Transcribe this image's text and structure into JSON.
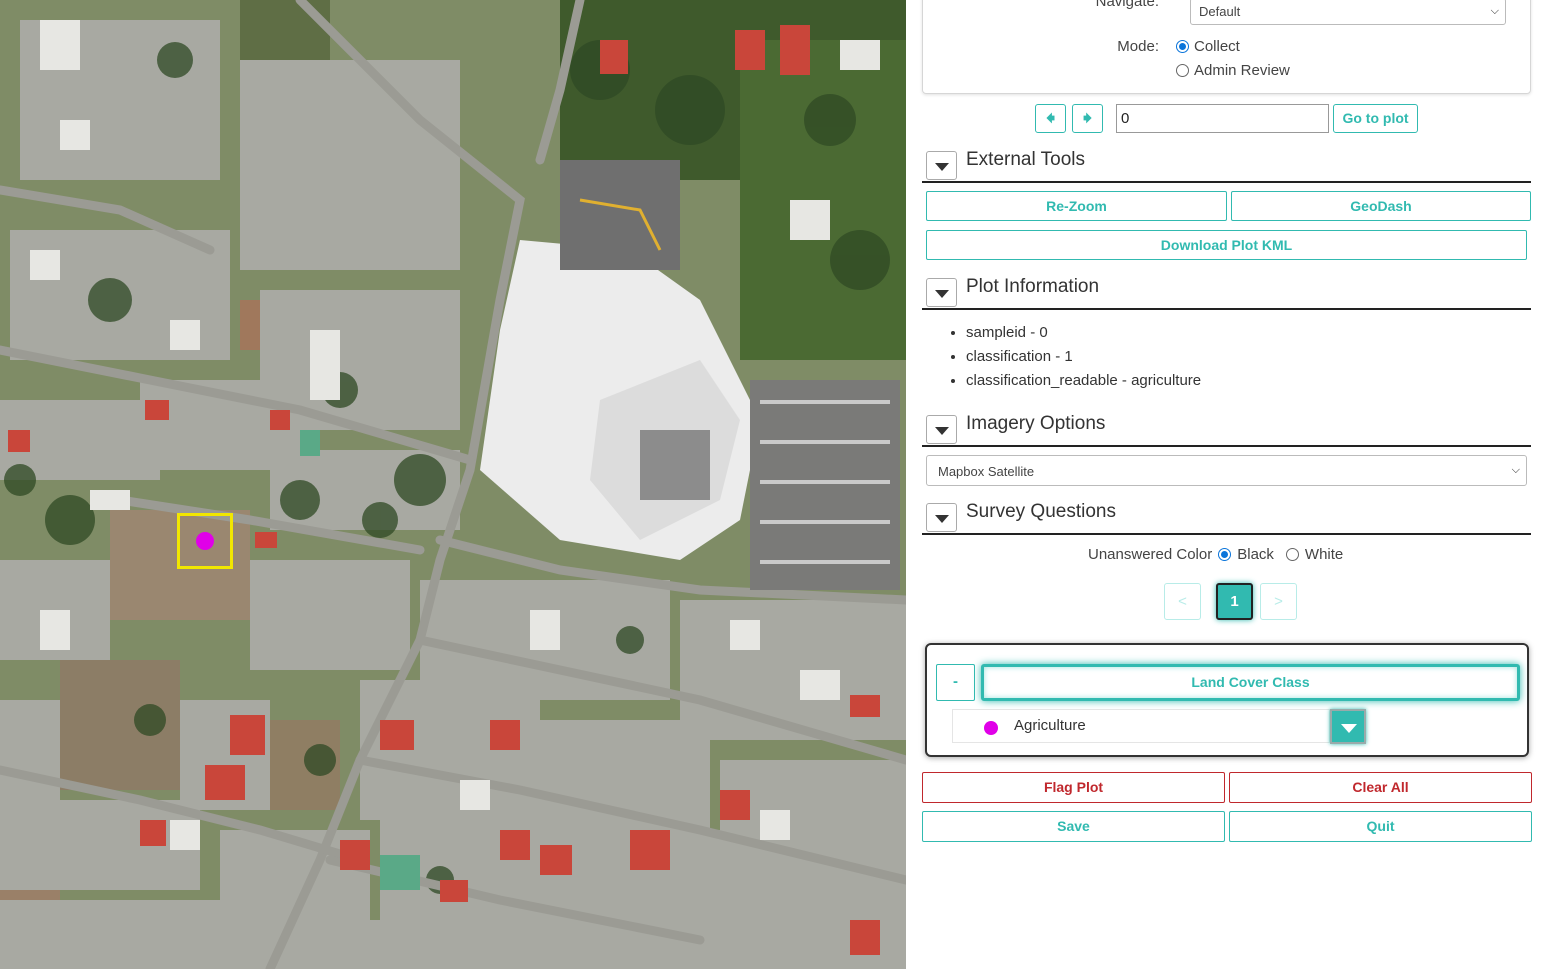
{
  "map": {
    "plot_marker_color": "#e000e8",
    "plot_box_color": "#f2e600"
  },
  "navigation": {
    "navigate_label": "Navigate:",
    "navigate_value": "Default",
    "mode_label": "Mode:",
    "mode_options": [
      "Collect",
      "Admin Review"
    ],
    "mode_selected": "Collect",
    "prev_icon": "arrow-left-icon",
    "next_icon": "arrow-right-icon",
    "plot_input_value": "0",
    "go_to_plot_label": "Go to plot"
  },
  "external_tools": {
    "title": "External Tools",
    "rezoom_label": "Re-Zoom",
    "geodash_label": "GeoDash",
    "download_kml_label": "Download Plot KML"
  },
  "plot_information": {
    "title": "Plot Information",
    "items": [
      "sampleid - 0",
      "classification - 1",
      "classification_readable - agriculture"
    ]
  },
  "imagery_options": {
    "title": "Imagery Options",
    "selected": "Mapbox Satellite"
  },
  "survey_questions": {
    "title": "Survey Questions",
    "unanswered_color_label": "Unanswered Color",
    "color_options": [
      "Black",
      "White"
    ],
    "color_selected": "Black",
    "pagination": {
      "prev": "<",
      "current": "1",
      "next": ">"
    },
    "question": {
      "collapse_label": "-",
      "label": "Land Cover Class",
      "answer": "Agriculture",
      "answer_color": "#e000e8"
    }
  },
  "actions": {
    "flag_plot": "Flag Plot",
    "clear_all": "Clear All",
    "save": "Save",
    "quit": "Quit"
  },
  "colors": {
    "accent": "#31bab0",
    "danger": "#c0282d"
  }
}
